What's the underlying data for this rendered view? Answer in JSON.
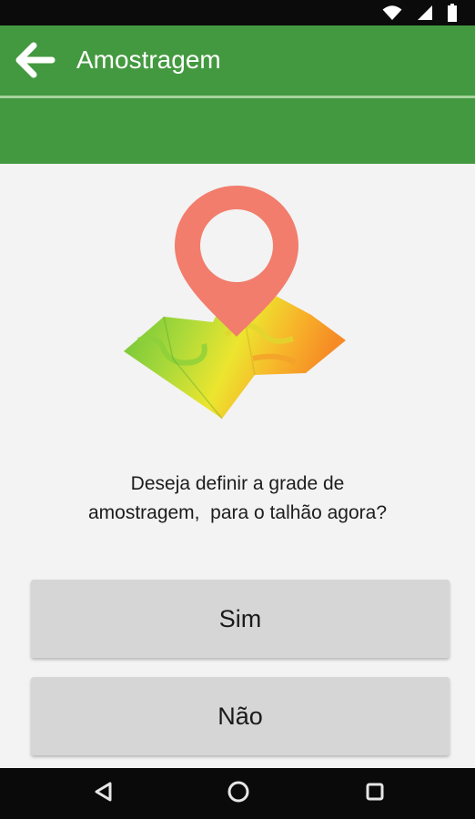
{
  "app_bar": {
    "title": "Amostragem",
    "back_icon": "arrow-left-icon",
    "color": "#43993f"
  },
  "status_bar": {
    "icons": [
      "wifi-icon",
      "cell-signal-icon",
      "battery-icon"
    ]
  },
  "illustration": {
    "icon": "map-pin-icon",
    "pin_color": "#f27d6c"
  },
  "dialog": {
    "question_line1": "Deseja definir a grade de",
    "question_line2": "amostragem,  para o talhão agora?",
    "yes_label": "Sim",
    "no_label": "Não"
  },
  "nav_bar": {
    "icons": [
      "nav-back-icon",
      "nav-home-icon",
      "nav-recents-icon"
    ]
  }
}
